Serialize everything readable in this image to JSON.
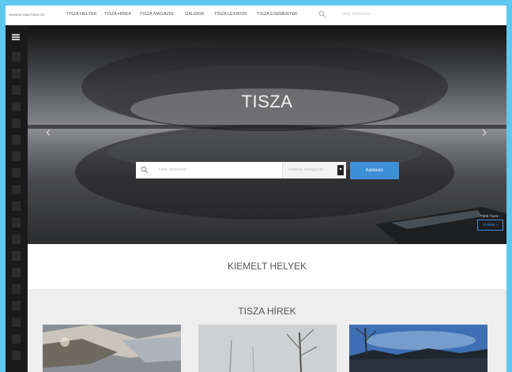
{
  "site": {
    "logo": "WWW.ELOMATISZA.HU"
  },
  "nav": {
    "items": [
      "TISZA HELYEK",
      "TISZA HÍREK",
      "TISZA MAGAZIN",
      "GALÉRIA",
      "TISZA LEXIKON",
      "TISZA ESEMÉNYEK"
    ],
    "search_placeholder": "Hely keresése"
  },
  "hero": {
    "title": "TISZA",
    "search_placeholder": "Hely keresése",
    "category_placeholder": "Válassz kategóriát",
    "search_button": "Keresés",
    "more_text": "Több Tisza -",
    "more_button": "További »"
  },
  "sections": {
    "featured_title": "KIEMELT HELYEK",
    "news_title": "TISZA HÍREK"
  },
  "colors": {
    "accent": "#3d8fd6",
    "page_border": "#5ec8f0"
  }
}
